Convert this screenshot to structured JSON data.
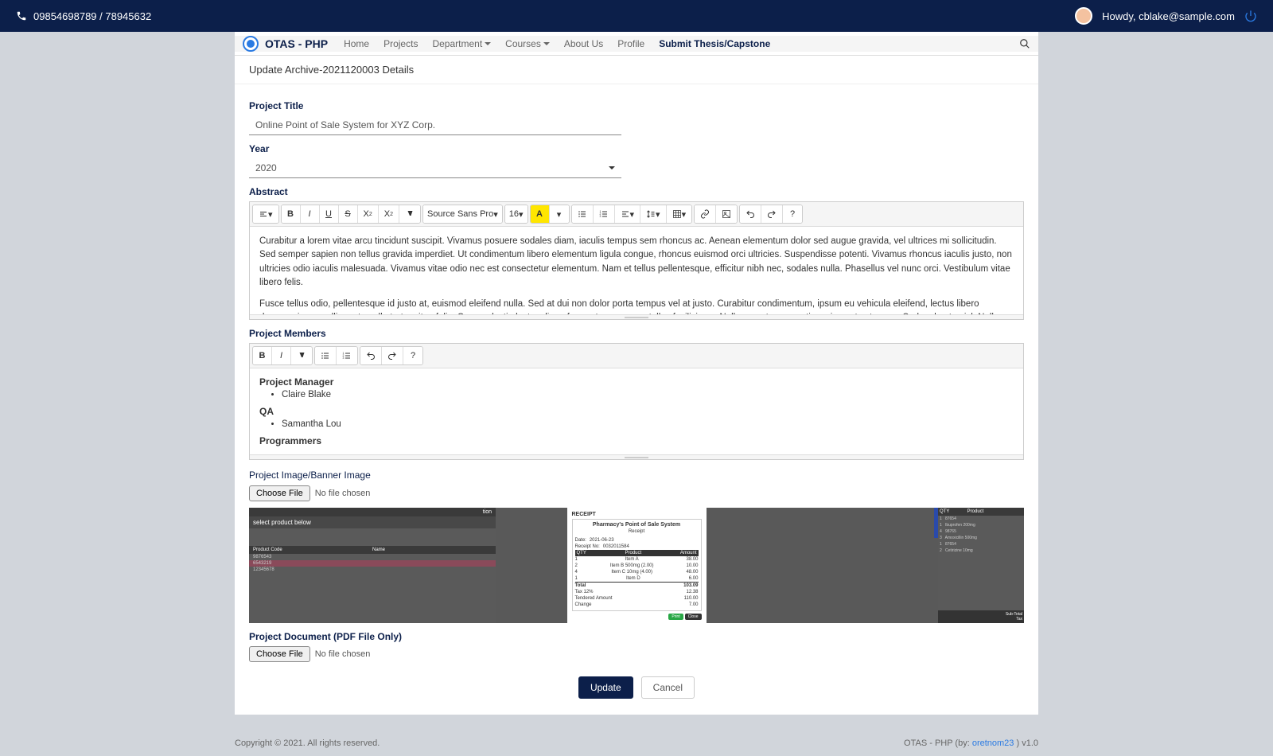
{
  "topbar": {
    "phone": "09854698789 / 78945632",
    "greeting": "Howdy, cblake@sample.com"
  },
  "nav": {
    "brand": "OTAS - PHP",
    "links": {
      "home": "Home",
      "projects": "Projects",
      "department": "Department",
      "courses": "Courses",
      "about": "About Us",
      "profile": "Profile",
      "submit": "Submit Thesis/Capstone"
    }
  },
  "page": {
    "header": "Update Archive-2021120003 Details"
  },
  "form": {
    "title_label": "Project Title",
    "title_value": "Online Point of Sale System for XYZ Corp.",
    "year_label": "Year",
    "year_value": "2020",
    "abstract_label": "Abstract",
    "abstract_p1": "Curabitur a lorem vitae arcu tincidunt suscipit. Vivamus posuere sodales diam, iaculis tempus sem rhoncus ac. Aenean elementum dolor sed augue gravida, vel ultrices mi sollicitudin. Sed semper sapien non tellus gravida imperdiet. Ut condimentum libero elementum ligula congue, rhoncus euismod orci ultricies. Suspendisse potenti. Vivamus rhoncus iaculis justo, non ultricies odio iaculis malesuada. Vivamus vitae odio nec est consectetur elementum. Nam et tellus pellentesque, efficitur nibh nec, sodales nulla. Phasellus vel nunc orci. Vestibulum vitae libero felis.",
    "abstract_p2": "Fusce tellus odio, pellentesque id justo at, euismod eleifend nulla. Sed at dui non dolor porta tempus vel at justo. Curabitur condimentum, ipsum eu vehicula eleifend, lectus libero rhoncus risus, mollis porta nulla tortor vitae felis. Cras molestie lectus diam, fermentum posuere tellus facilisis ac. Nulla eu ante venenatis orci egestas tempor. Sed sed ante nisl. Nulla vitae risus quam. Donec eu neque eget urna pellentesque maximus. Mauris et lacus elit.",
    "members_label": "Project Members",
    "members": {
      "role1": "Project Manager",
      "person1": "Claire Blake",
      "role2": "QA",
      "person2": "Samantha Lou",
      "role3": "Programmers"
    },
    "image_label": "Project Image/Banner Image",
    "doc_label": "Project Document (PDF File Only)",
    "choose_file": "Choose File",
    "no_file": "No file chosen",
    "update_btn": "Update",
    "cancel_btn": "Cancel"
  },
  "editor": {
    "font_family": "Source Sans Pro",
    "font_size": "16",
    "highlight_letter": "A"
  },
  "receipt": {
    "title": "Pharmacy's Point of Sale System",
    "subtitle": "Receipt",
    "date_label": "Date:",
    "date_value": "2021-06-23",
    "receipt_label": "Receipt No:",
    "receipt_value": "0032011584",
    "qty": "QTY",
    "product": "Product",
    "amount": "Amount",
    "total": "Total",
    "tax": "Tax 12%",
    "tendered": "Tendered Amount",
    "change": "Change",
    "print": "Print",
    "close": "Close"
  },
  "preview_left": {
    "title_frag": "tion",
    "subtitle": "select product below",
    "code": "Product Code",
    "name": "Name"
  },
  "footer": {
    "copyright": "Copyright © 2021. All rights reserved.",
    "right_prefix": "OTAS - PHP (by: ",
    "right_link": "oretnom23",
    "right_suffix": " ) v1.0"
  }
}
